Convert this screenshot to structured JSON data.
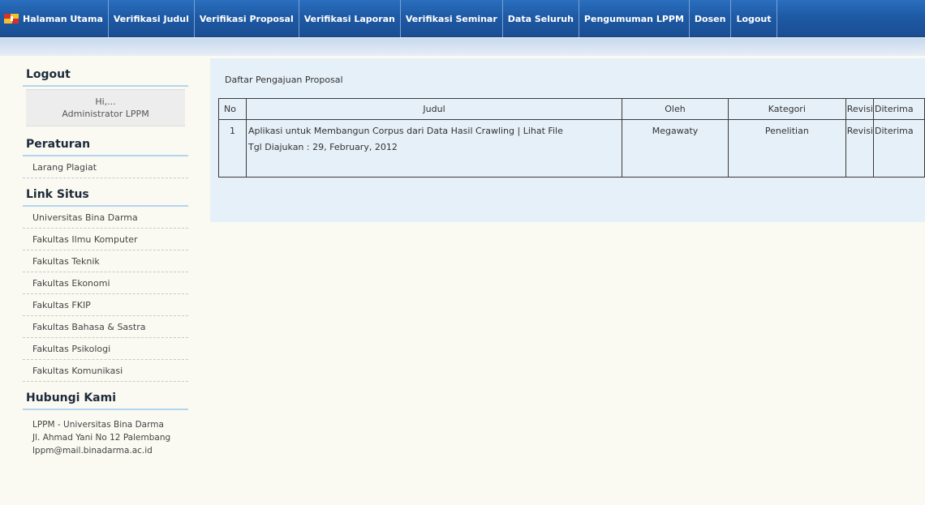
{
  "nav": {
    "items": [
      {
        "label": "Halaman Utama"
      },
      {
        "label": "Verifikasi Judul"
      },
      {
        "label": "Verifikasi Proposal"
      },
      {
        "label": "Verifikasi Laporan"
      },
      {
        "label": "Verifikasi Seminar"
      },
      {
        "label": "Data Seluruh"
      },
      {
        "label": "Pengumuman LPPM"
      },
      {
        "label": "Dosen"
      },
      {
        "label": "Logout"
      }
    ],
    "home_icon": "flag-logo-icon"
  },
  "sidebar": {
    "logout": {
      "heading": "Logout",
      "greeting": "Hi,...",
      "user": "Administrator LPPM"
    },
    "peraturan": {
      "heading": "Peraturan",
      "items": [
        {
          "label": "Larang Plagiat"
        }
      ]
    },
    "link_situs": {
      "heading": "Link Situs",
      "items": [
        {
          "label": "Universitas Bina Darma"
        },
        {
          "label": "Fakultas Ilmu Komputer"
        },
        {
          "label": "Fakultas Teknik"
        },
        {
          "label": "Fakultas Ekonomi"
        },
        {
          "label": "Fakultas FKIP"
        },
        {
          "label": "Fakultas Bahasa & Sastra"
        },
        {
          "label": "Fakultas Psikologi"
        },
        {
          "label": "Fakultas Komunikasi"
        }
      ]
    },
    "hubungi": {
      "heading": "Hubungi Kami",
      "lines": [
        "LPPM - Universitas Bina Darma",
        "Jl. Ahmad Yani No 12 Palembang",
        "lppm@mail.binadarma.ac.id"
      ]
    }
  },
  "main": {
    "title": "Daftar Pengajuan Proposal",
    "table": {
      "headers": {
        "no": "No",
        "judul": "Judul",
        "oleh": "Oleh",
        "kategori": "Kategori",
        "revisi": "Revisi",
        "diterima": "Diterima"
      },
      "rows": [
        {
          "no": "1",
          "judul": "Aplikasi untuk Membangun Corpus dari Data Hasil Crawling",
          "separator": " | ",
          "file_link": "Lihat File",
          "submitted": "Tgl Diajukan : 29, February, 2012",
          "oleh": "Megawaty",
          "kategori": "Penelitian",
          "revisi": "Revisi",
          "diterima": "Diterima"
        }
      ]
    }
  },
  "colors": {
    "nav_bg": "#1e5aa5",
    "content_bg": "#e6f0f8",
    "page_bg": "#fafaf3"
  }
}
